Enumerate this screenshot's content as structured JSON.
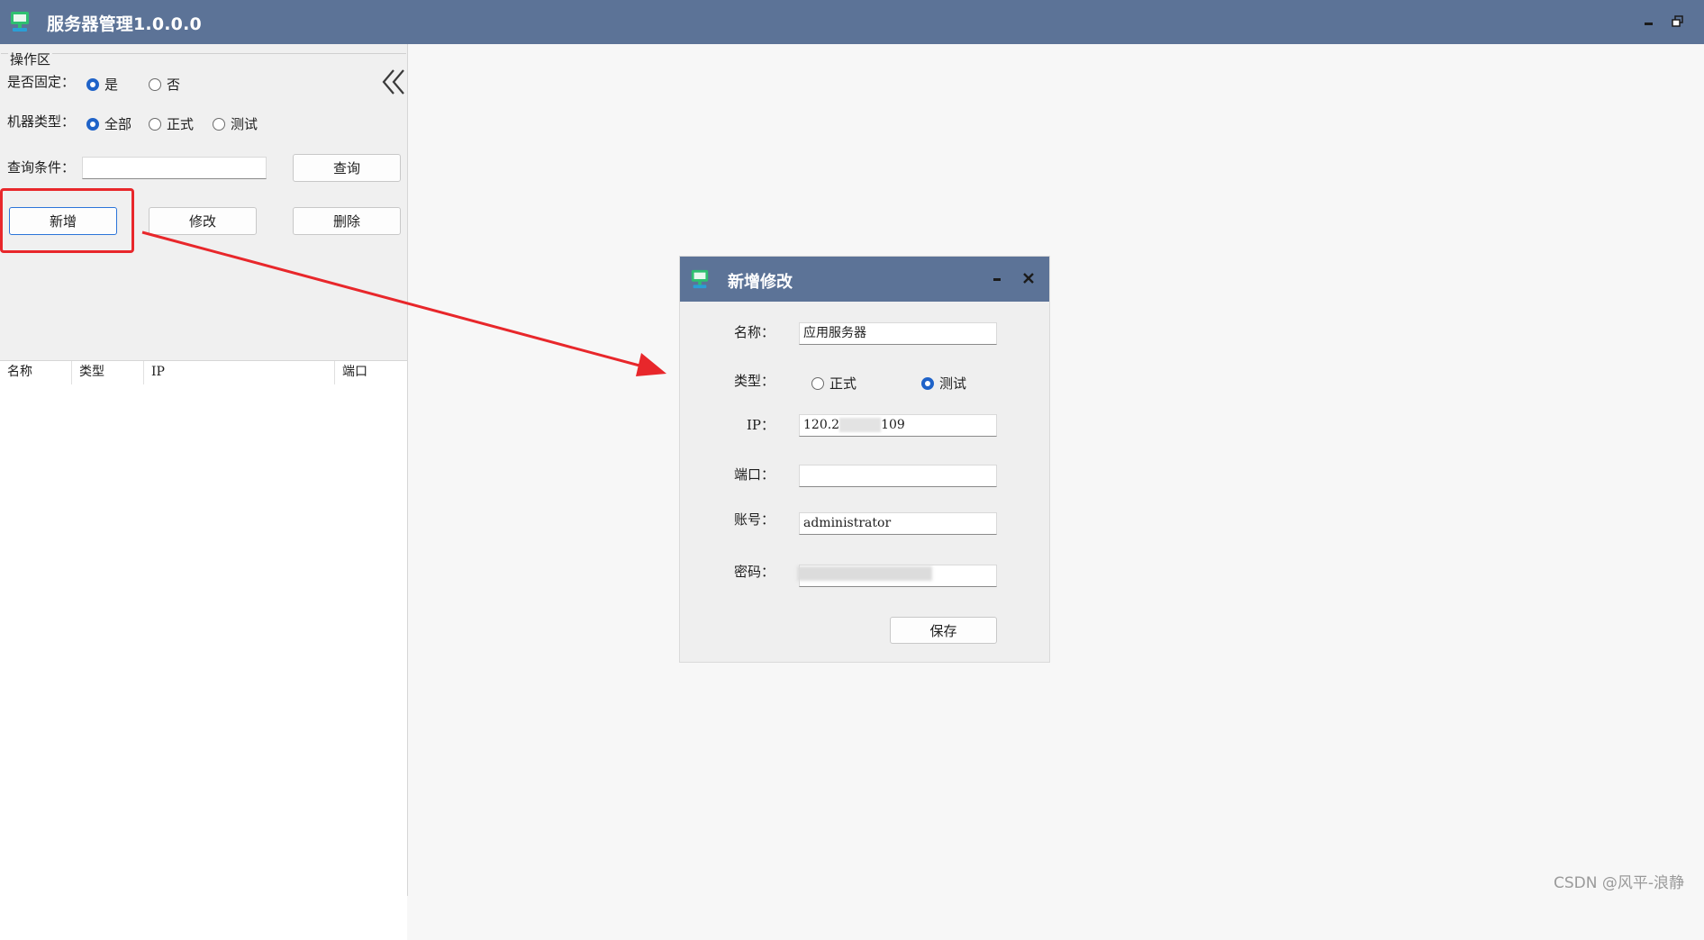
{
  "window": {
    "title": "服务器管理1.0.0.0",
    "icon": "monitor-icon",
    "controls": [
      "minimize-icon",
      "restore-icon"
    ]
  },
  "left_panel": {
    "group_title": "操作区",
    "collapse_icon": "double-chevron-left-icon",
    "fixed": {
      "label": "是否固定：",
      "options": [
        {
          "label": "是",
          "checked": true
        },
        {
          "label": "否",
          "checked": false
        }
      ]
    },
    "machine_type": {
      "label": "机器类型：",
      "options": [
        {
          "label": "全部",
          "checked": true
        },
        {
          "label": "正式",
          "checked": false
        },
        {
          "label": "测试",
          "checked": false
        }
      ]
    },
    "query": {
      "label": "查询条件：",
      "value": "",
      "button": "查询"
    },
    "actions": {
      "add": "新增",
      "edit": "修改",
      "delete": "删除"
    },
    "table": {
      "columns": [
        "名称",
        "类型",
        "IP",
        "端口"
      ],
      "rows": []
    }
  },
  "annotation": {
    "highlight_color": "#e8272b"
  },
  "dialog": {
    "title": "新增修改",
    "icon": "monitor-icon",
    "name": {
      "label": "名称：",
      "value": "应用服务器"
    },
    "type": {
      "label": "类型：",
      "options": [
        {
          "label": "正式",
          "checked": false
        },
        {
          "label": "测试",
          "checked": true
        }
      ]
    },
    "ip": {
      "label": "IP：",
      "value_start": "120.2",
      "value_end": "109"
    },
    "port": {
      "label": "端口：",
      "value": ""
    },
    "account": {
      "label": "账号：",
      "value": "administrator"
    },
    "password": {
      "label": "密码：",
      "value": ""
    },
    "save_button": "保存"
  },
  "watermark": "CSDN @风平-浪静",
  "colors": {
    "titlebar": "#5c7397",
    "radio_checked": "#1f63c8",
    "primary_border": "#2b74d9"
  }
}
